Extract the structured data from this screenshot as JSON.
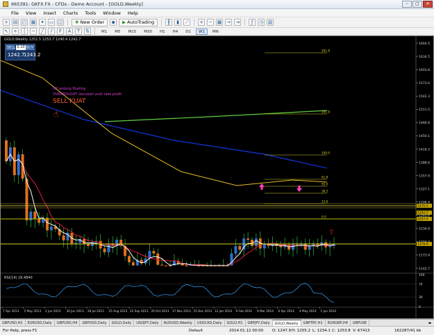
{
  "window": {
    "title": "665391: GKFX FX - CFDs - Demo Account - [GOLD,Weekly]"
  },
  "menu": [
    "File",
    "View",
    "Insert",
    "Charts",
    "Tools",
    "Window",
    "Help"
  ],
  "toolbar": {
    "new_order": "New Order",
    "autotrading": "AutoTrading"
  },
  "timeframes": [
    "M1",
    "M5",
    "M15",
    "M30",
    "H1",
    "H4",
    "D1",
    "W1",
    "MN"
  ],
  "active_timeframe": "W1",
  "chart": {
    "header": "GOLD,Weekly  1251.5 1253.7 1240.4 1242.7",
    "annotations": {
      "line1": "OP sedang floating",
      "line2": "OVERBOUGHT..berubah arah take profit",
      "line3": "SELL KUAT",
      "hand_glyph": "☝",
      "arrow_glyph": "⇧"
    },
    "price_labels": [
      "1664.5",
      "1634.5",
      "1603.8",
      "1573.0",
      "1542.3",
      "1511.5",
      "1480.8",
      "1450.1",
      "1419.3",
      "1388.6",
      "1357.9",
      "1327.1",
      "1296.4",
      "1265.6",
      "1234.9",
      "1204.2",
      "1173.4",
      "1142.7"
    ],
    "price_tags": [
      {
        "text": "1242.7",
        "color": "#c0a000"
      },
      {
        "text": "1257.4",
        "color": "#c0a000"
      },
      {
        "text": "1179.4",
        "color": "#c0a000"
      },
      {
        "text": "1275.5",
        "color": "#c0a000"
      }
    ],
    "fib_levels": [
      {
        "label": "261.8"
      },
      {
        "label": "161.8"
      },
      {
        "label": "100.0"
      },
      {
        "label": "61.8"
      },
      {
        "label": "50.0"
      },
      {
        "label": "38.2"
      },
      {
        "label": "23.6"
      },
      {
        "label": "0.0"
      }
    ],
    "date_labels": [
      "7 Apr 2013",
      "5 May 2013",
      "2 Jun 2013",
      "30 Jun 2013",
      "28 Jul 2013",
      "25 Aug 2013",
      "22 Sep 2013",
      "20 Oct 2013",
      "17 Nov 2013",
      "15 Dec 2013",
      "12 Jan 2014",
      "9 Feb 2014",
      "9 Mar 2014",
      "6 Apr 2014",
      "4 May 2014",
      "1 Jun 2014"
    ],
    "rsi_label": "RSI(14) 29.4840",
    "rsi_scale": [
      "100",
      "70",
      "30",
      "0"
    ]
  },
  "trade_panel": {
    "sell": "SELL",
    "buy": "BUY",
    "lots": "0.10",
    "bid_big": "1242.7",
    "ask_big": "1243.2"
  },
  "tabs": [
    "GBPUSD,H1",
    "EURUSD,Daily",
    "GBPUSD,H4",
    "GBPUSD,Daily",
    "GOLD,Daily",
    "USDJPY,Daily",
    "AUDUSD,Weekly",
    "USDCAD,Daily",
    "GOLD,H1",
    "GBPJPY,Daily",
    "GOLD,Weekly",
    "GBPTRY,H1",
    "EURGBP,H4",
    "GBPUSE"
  ],
  "active_tab": "GOLD,Weekly",
  "status": {
    "help": "For Help, press F1",
    "profile": "Default",
    "datetime": "2014.01.12 00:00",
    "open": "O: 1247.9",
    "high": "H: 1255.2",
    "low": "L: 1234.1",
    "close": "C: 1253.8",
    "volume": "V: 67413",
    "traffic": "162287/41 kb"
  },
  "colors": {
    "bull": "#2f6fd0",
    "bear": "#e0701a",
    "ma_fast": "#ffffff",
    "ma_mid": "#e02040",
    "ma_slow": "#e6c020",
    "ma_long": "#1030c0",
    "ma_200": "#60d040",
    "fib": "#d8d020",
    "annotation": "#d040d0",
    "sell_text": "#ff6030"
  }
}
